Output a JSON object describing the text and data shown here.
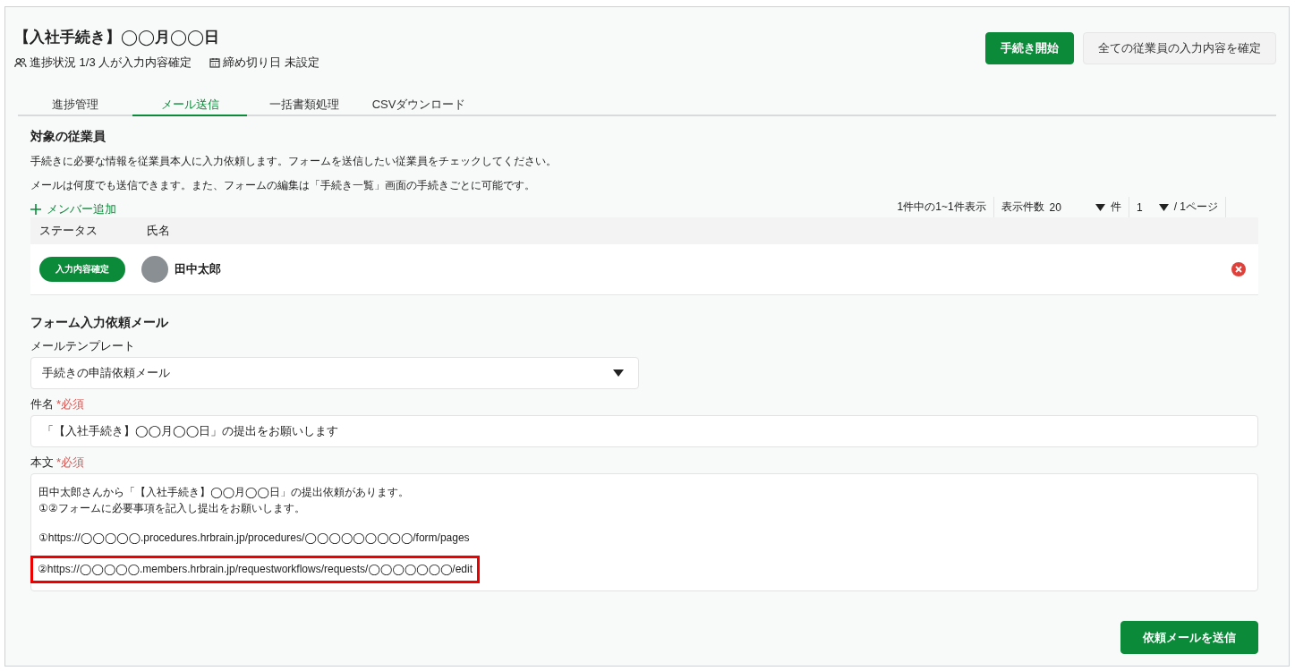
{
  "header": {
    "title": "【入社手続き】◯◯月◯◯日",
    "progress": "進捗状況 1/3 人が入力内容確定",
    "deadline": "締め切り日 未設定",
    "buttons": [
      {
        "label": "手続き開始",
        "kind": "primary"
      },
      {
        "label": "全ての従業員の入力内容を確定",
        "kind": "secondary"
      }
    ]
  },
  "tabs": [
    {
      "label": "進捗管理",
      "selected": false
    },
    {
      "label": "メール送信",
      "selected": true
    },
    {
      "label": "一括書類処理",
      "selected": false
    },
    {
      "label": "CSVダウンロード",
      "selected": false
    }
  ],
  "employees": {
    "title": "対象の従業員",
    "notes": [
      "手続きに必要な情報を従業員本人に入力依頼します。フォームを送信したい従業員をチェックしてください。",
      "メールは何度でも送信できます。また、フォームの編集は「手続き一覧」画面の手続きごとに可能です。"
    ],
    "add_label": "メンバー追加",
    "range": "1件中の1~1件表示",
    "per_page_label": "表示件数",
    "per_page": "20",
    "per_page_unit": "件",
    "page": "1",
    "page_total": "/ 1ページ",
    "columns": [
      "ステータス",
      "氏名"
    ],
    "rows": [
      {
        "status": "入力内容確定",
        "name": "田中太郎"
      }
    ]
  },
  "mail": {
    "title": "フォーム入力依頼メール",
    "template_label": "メールテンプレート",
    "template": "手続きの申請依頼メール",
    "subject_label": "件名",
    "subject_required": "*必須",
    "subject": "「【入社手続き】◯◯月◯◯日」の提出をお願いします",
    "body_label": "本文",
    "body_required": "*必須",
    "body": [
      {
        "lines": [
          "田中太郎さんから「【入社手続き】◯◯月◯◯日」の提出依頼があります。",
          "①②フォームに必要事項を記入し提出をお願いします。"
        ],
        "highlighted": false
      },
      {
        "lines": [
          "①https://◯◯◯◯◯.procedures.hrbrain.jp/procedures/◯◯◯◯◯◯◯◯◯/form/pages"
        ],
        "highlighted": false
      },
      {
        "lines": [
          "②https://◯◯◯◯◯.members.hrbrain.jp/requestworkflows/requests/◯◯◯◯◯◯◯/edit"
        ],
        "highlighted": true
      }
    ],
    "send": "依頼メールを送信"
  }
}
